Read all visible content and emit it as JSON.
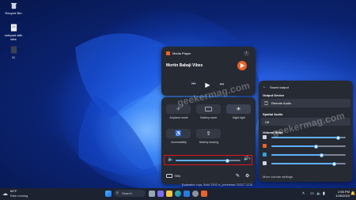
{
  "desktop": {
    "icons": [
      {
        "label": "Recycle Bin",
        "icon": "recycle-bin-icon"
      },
      {
        "label": "notepad with tabs",
        "icon": "text-file-icon"
      },
      {
        "label": "11",
        "icon": "text-file-icon"
      }
    ],
    "notice_lines": [
      "Evaluation copy. Build 23H2.ni_prerelease.231117-1215",
      "Evaluation copy. Build 23H2.ni_prerelease.231117-1215"
    ]
  },
  "media_player": {
    "app_name": "Media Player",
    "track_title": "Mortin Babaji Vibes",
    "app_icon": "media-player-icon"
  },
  "quick_settings": {
    "tiles": [
      {
        "label": "Airplane mode",
        "icon": "airplane-icon",
        "active": false
      },
      {
        "label": "Battery saver",
        "icon": "battery-icon",
        "active": false
      },
      {
        "label": "Night light",
        "icon": "sun-icon",
        "active": true
      },
      {
        "label": "Accessibility",
        "icon": "accessibility-icon",
        "active": false
      },
      {
        "label": "Nearby sharing",
        "icon": "share-icon",
        "active": false
      }
    ],
    "volume_percent": 80,
    "battery_label": "73%",
    "accent": "#5fb0ff",
    "highlight_color": "#e0151b"
  },
  "sound_output": {
    "title": "Sound output",
    "output_device_label": "Output Device",
    "device_name": "Remote Audio",
    "spatial_label": "Spatial Audio",
    "spatial_value": "Off",
    "mixer_label": "Volume Mixer",
    "mixer_levels": [
      90,
      60,
      68,
      85
    ],
    "more_settings": "More volume settings"
  },
  "watermark": "geekermag.com",
  "taskbar": {
    "weather_temp": "64°F",
    "weather_desc": "Rain coming",
    "search_placeholder": "Search",
    "time": "2:55 PM",
    "date": "1/26/2023"
  }
}
